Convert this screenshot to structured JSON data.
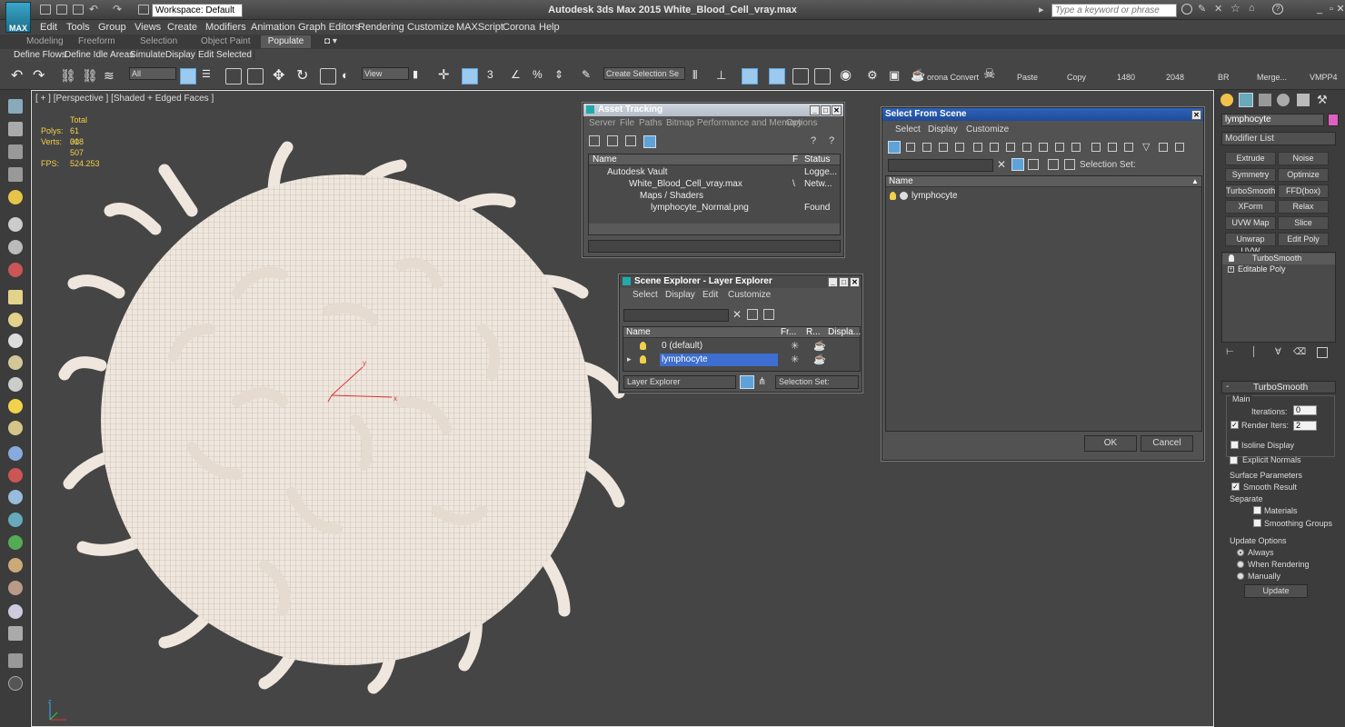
{
  "app": {
    "logo_label": "MAX",
    "title": "Autodesk 3ds Max  2015     White_Blood_Cell_vray.max",
    "workspace": "Workspace: Default",
    "search_placeholder": "Type a keyword or phrase"
  },
  "menu": [
    "Edit",
    "Tools",
    "Group",
    "Views",
    "Create",
    "Modifiers",
    "Animation",
    "Graph Editors",
    "Rendering",
    "Customize",
    "MAXScript",
    "Corona",
    "Help"
  ],
  "ribbon": {
    "tabs": [
      "Modeling",
      "Freeform",
      "Selection",
      "Object Paint"
    ],
    "active_tab": "Populate"
  },
  "subtoolbar": [
    "Define Flows",
    "Define Idle Areas",
    "Simulate",
    "Display",
    "Edit Selected"
  ],
  "toolbar": {
    "filter": "All",
    "ref_coord": "View",
    "selection_set": "Create Selection Se",
    "labels": [
      "orona Convert",
      "Paste",
      "Copy",
      "1480",
      "2048",
      "BR",
      "Merge...",
      "VMPP4"
    ]
  },
  "viewport": {
    "label": "[ + ] [Perspective ] [Shaded + Edged Faces ]",
    "stats": {
      "total_label": "Total",
      "polys_label": "Polys:",
      "polys": "61 018",
      "verts_label": "Verts:",
      "verts": "30 507",
      "fps_label": "FPS:",
      "fps": "524.253"
    },
    "gizmo": {
      "x": "x",
      "y": "y",
      "z": "z"
    }
  },
  "asset_tracking": {
    "title": "Asset Tracking",
    "menu": [
      "Server",
      "File",
      "Paths",
      "Bitmap Performance and Memory",
      "Options"
    ],
    "col_name": "Name",
    "col_f": "F",
    "col_status": "Status",
    "rows": [
      {
        "name": "Autodesk Vault",
        "f": "",
        "status": "Logge..."
      },
      {
        "name": "White_Blood_Cell_vray.max",
        "f": "\\",
        "status": "Netw..."
      },
      {
        "name": "Maps / Shaders",
        "f": "",
        "status": ""
      },
      {
        "name": "lymphocyte_Normal.png",
        "f": "",
        "status": "Found"
      }
    ]
  },
  "scene_explorer": {
    "title": "Scene Explorer - Layer Explorer",
    "menu": [
      "Select",
      "Display",
      "Edit",
      "Customize"
    ],
    "columns": [
      "Name",
      "Fr...",
      "R...",
      "Displa..."
    ],
    "rows": [
      {
        "name": "0 (default)",
        "selected": false
      },
      {
        "name": "lymphocyte",
        "selected": true
      }
    ],
    "footer_dropdown": "Layer Explorer",
    "selection_set": "Selection Set:"
  },
  "select_from_scene": {
    "title": "Select From Scene",
    "menu": [
      "Select",
      "Display",
      "Customize"
    ],
    "selection_set": "Selection Set:",
    "col_name": "Name",
    "rows": [
      "lymphocyte"
    ],
    "ok": "OK",
    "cancel": "Cancel"
  },
  "command_panel": {
    "object_name": "lymphocyte",
    "modifier_list": "Modifier List",
    "buttons": [
      "Extrude",
      "Noise",
      "Symmetry",
      "Optimize",
      "TurboSmooth",
      "FFD(box)",
      "XForm",
      "Relax",
      "UVW Map",
      "Slice",
      "Unwrap UVW",
      "Edit Poly"
    ],
    "stack": [
      "TurboSmooth",
      "Editable Poly"
    ],
    "rollout": {
      "title": "TurboSmooth",
      "main": "Main",
      "iterations_label": "Iterations:",
      "iterations": "0",
      "render_iters_label": "Render Iters:",
      "render_iters": "2",
      "isoline": "Isoline Display",
      "explicit_normals": "Explicit Normals",
      "surface_params": "Surface Parameters",
      "smooth_result": "Smooth Result",
      "separate": "Separate",
      "materials": "Materials",
      "smoothing_groups": "Smoothing Groups",
      "update_options": "Update Options",
      "always": "Always",
      "when_rendering": "When Rendering",
      "manually": "Manually",
      "update_button": "Update"
    }
  },
  "colors": {
    "accent": "#3d6ed0",
    "stats": "#f2d04b",
    "cell": "#efe6dd",
    "panel": "#3c3c3c"
  }
}
